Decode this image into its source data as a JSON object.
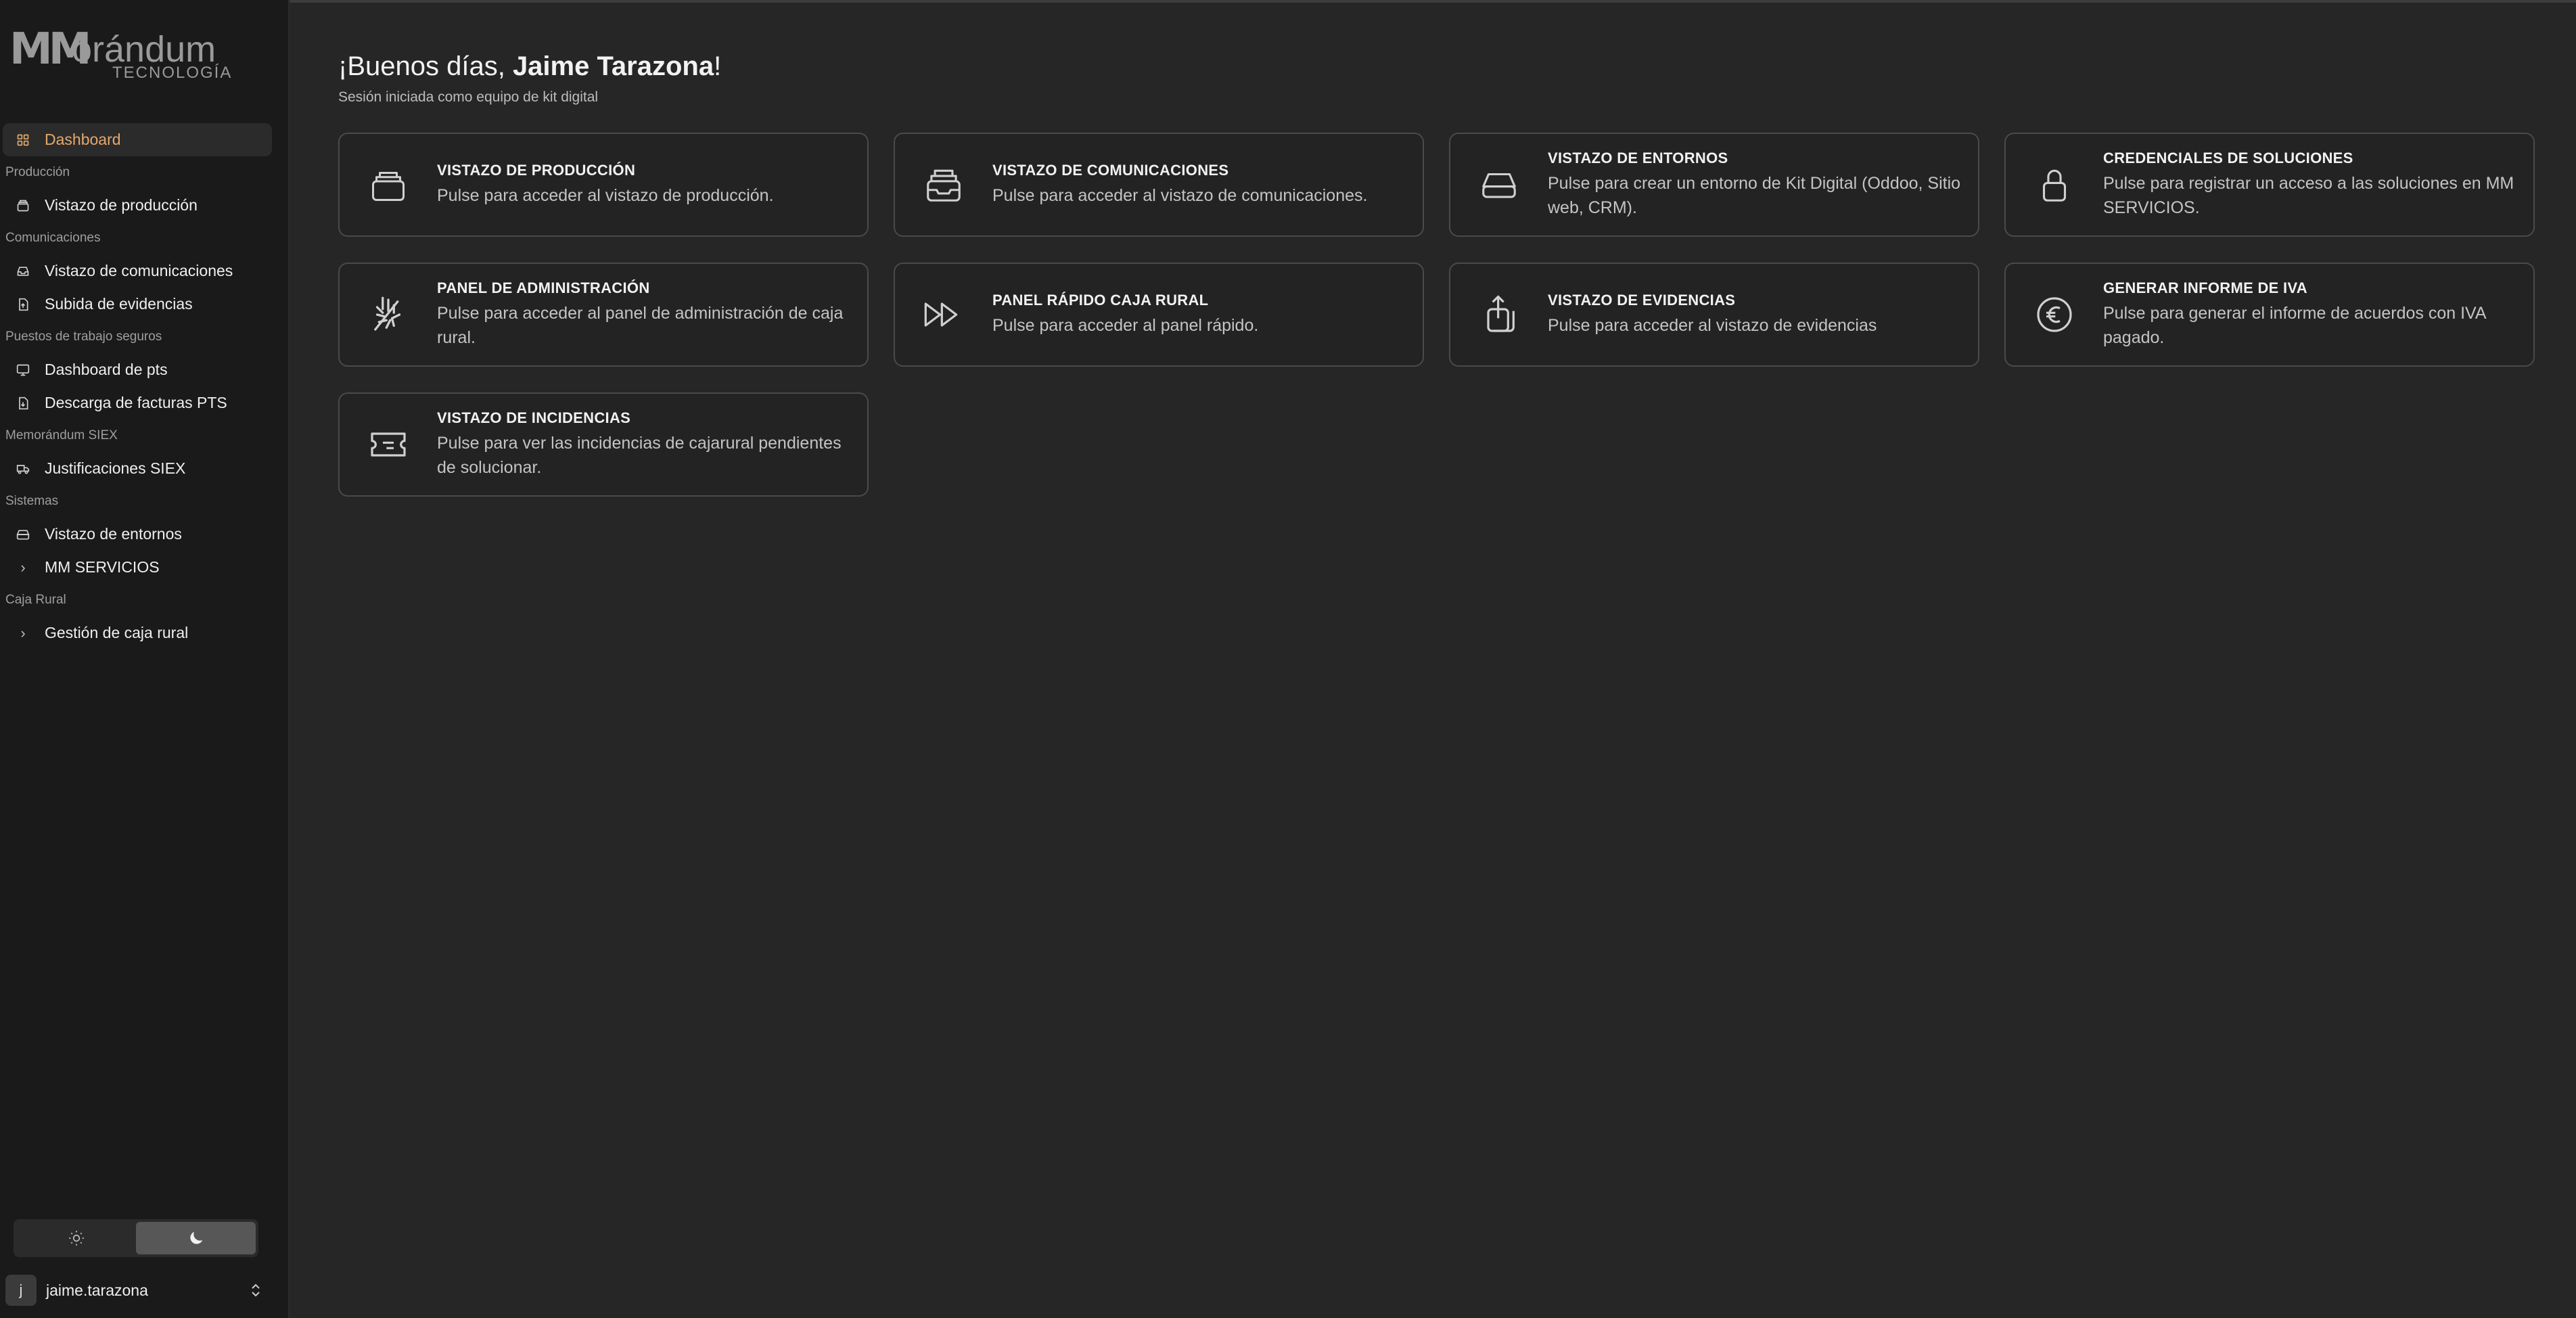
{
  "brand": {
    "logo_mm": "MM",
    "logo_word": "orándum",
    "logo_sub": "TECNOLOGÍA"
  },
  "sidebar": {
    "active_item": {
      "label": "Dashboard",
      "icon": "dashboard-icon"
    },
    "sections": [
      {
        "title": "Producción",
        "items": [
          {
            "label": "Vistazo de producción",
            "icon": "archive-icon"
          }
        ]
      },
      {
        "title": "Comunicaciones",
        "items": [
          {
            "label": "Vistazo de comunicaciones",
            "icon": "inbox-icon"
          },
          {
            "label": "Subida de evidencias",
            "icon": "file-upload-icon"
          }
        ]
      },
      {
        "title": "Puestos de trabajo seguros",
        "items": [
          {
            "label": "Dashboard de pts",
            "icon": "monitor-icon"
          },
          {
            "label": "Descarga de facturas PTS",
            "icon": "file-download-icon"
          }
        ]
      },
      {
        "title": "Memorándum SIEX",
        "items": [
          {
            "label": "Justificaciones SIEX",
            "icon": "truck-icon"
          }
        ]
      },
      {
        "title": "Sistemas",
        "items": [
          {
            "label": "Vistazo de entornos",
            "icon": "hard-drive-icon"
          },
          {
            "label": "MM SERVICIOS",
            "icon": "chevron-right-icon"
          }
        ]
      },
      {
        "title": "Caja Rural",
        "items": [
          {
            "label": "Gestión de caja rural",
            "icon": "chevron-right-icon"
          }
        ]
      }
    ]
  },
  "theme": {
    "options": [
      "light",
      "dark"
    ],
    "selected": "dark"
  },
  "user": {
    "initial": "j",
    "username": "jaime.tarazona"
  },
  "header": {
    "greeting_prefix": "¡Buenos días, ",
    "user_name": "Jaime Tarazona",
    "greeting_suffix": "!",
    "subtitle": "Sesión iniciada como equipo de kit digital"
  },
  "cards": [
    {
      "title": "VISTAZO DE PRODUCCIÓN",
      "desc": "Pulse para acceder al vistazo de producción.",
      "icon": "archive-icon"
    },
    {
      "title": "VISTAZO DE COMUNICACIONES",
      "desc": "Pulse para acceder al vistazo de comunicaciones.",
      "icon": "inbox-icon"
    },
    {
      "title": "VISTAZO DE ENTORNOS",
      "desc": "Pulse para crear un entorno de Kit Digital (Oddoo, Sitio web, CRM).",
      "icon": "hard-drive-icon"
    },
    {
      "title": "CREDENCIALES DE SOLUCIONES",
      "desc": "Pulse para registrar un acceso a las soluciones en MM SERVICIOS.",
      "icon": "lock-icon"
    },
    {
      "title": "PANEL DE ADMINISTRACIÓN",
      "desc": "Pulse para acceder al panel de administración de caja rural.",
      "icon": "wheat-icon"
    },
    {
      "title": "PANEL RÁPIDO CAJA RURAL",
      "desc": "Pulse para acceder al panel rápido.",
      "icon": "fast-forward-icon"
    },
    {
      "title": "VISTAZO DE EVIDENCIAS",
      "desc": "Pulse para acceder al vistazo de evidencias",
      "icon": "share-files-icon"
    },
    {
      "title": "GENERAR INFORME DE IVA",
      "desc": "Pulse para generar el informe de acuerdos con IVA pagado.",
      "icon": "euro-icon"
    },
    {
      "title": "VISTAZO DE INCIDENCIAS",
      "desc": "Pulse para ver las incidencias de cajarural pendientes de solucionar.",
      "icon": "ticket-icon"
    }
  ],
  "colors": {
    "accent": "#e6a96b",
    "background": "#262626",
    "sidebar": "#1a1a1a",
    "card_border": "#4a4a4a"
  }
}
